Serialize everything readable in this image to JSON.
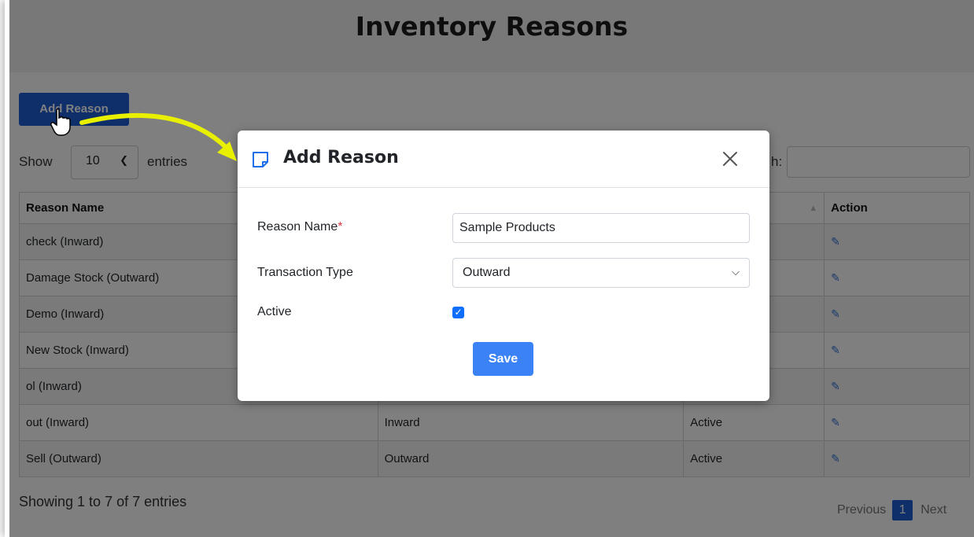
{
  "page": {
    "title": "Inventory Reasons",
    "add_button": "Add Reason",
    "show_label": "Show",
    "entries_value": "10",
    "entries_label": "entries",
    "search_label_partial": "h:",
    "info": "Showing 1 to 7 of 7 entries",
    "pager": {
      "previous": "Previous",
      "current": "1",
      "next": "Next"
    }
  },
  "table": {
    "headers": [
      "Reason Name",
      "",
      "",
      "Action"
    ],
    "rows": [
      {
        "name": "check (Inward)",
        "type": "",
        "status": ""
      },
      {
        "name": "Damage Stock (Outward)",
        "type": "",
        "status": ""
      },
      {
        "name": "Demo (Inward)",
        "type": "",
        "status": ""
      },
      {
        "name": "New Stock (Inward)",
        "type": "",
        "status": ""
      },
      {
        "name": "ol (Inward)",
        "type": "",
        "status": ""
      },
      {
        "name": "out (Inward)",
        "type": "Inward",
        "status": "Active"
      },
      {
        "name": "Sell (Outward)",
        "type": "Outward",
        "status": "Active"
      }
    ]
  },
  "modal": {
    "title": "Add Reason",
    "reason_name_label": "Reason Name",
    "required_mark": "*",
    "reason_name_value": "Sample Products",
    "transaction_type_label": "Transaction Type",
    "transaction_type_value": "Outward",
    "active_label": "Active",
    "active_checked": true,
    "save_label": "Save"
  },
  "colors": {
    "primary": "#1f5fd6",
    "save": "#3b82f6",
    "arrow": "#e8f000",
    "required": "#dc3545"
  },
  "icons": [
    "note-icon",
    "close-icon",
    "edit-icon",
    "sort-icon",
    "chevron-down-icon",
    "hand-cursor-icon",
    "pointer-arrow-annotation"
  ]
}
